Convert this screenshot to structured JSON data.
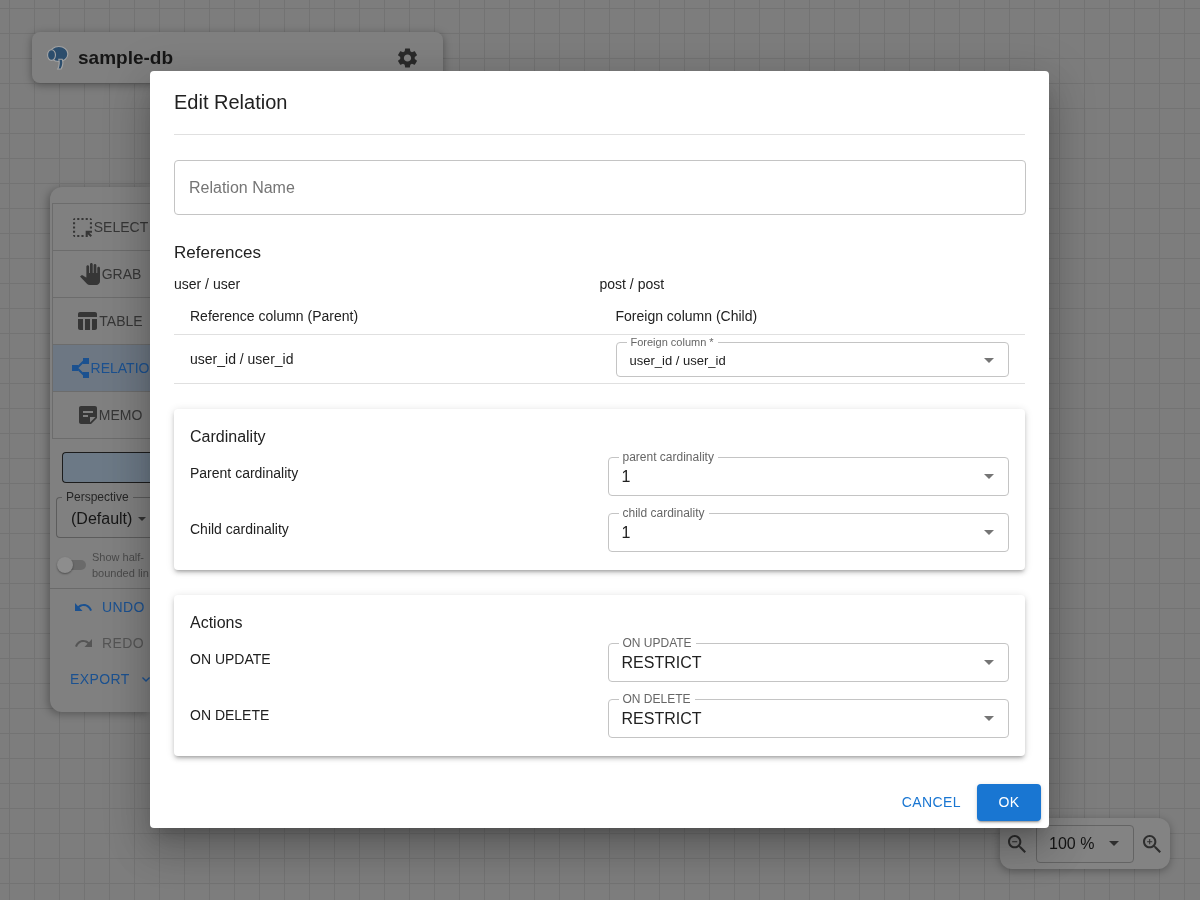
{
  "header": {
    "title": "sample-db"
  },
  "toolbar": {
    "tools": [
      {
        "kind": "select",
        "label": "SELECT",
        "selected": false
      },
      {
        "kind": "grab",
        "label": "GRAB",
        "selected": false
      },
      {
        "kind": "table",
        "label": "TABLE",
        "selected": false
      },
      {
        "kind": "relation",
        "label": "RELATIO",
        "selected": true
      },
      {
        "kind": "memo",
        "label": "MEMO",
        "selected": false
      }
    ],
    "perspective": {
      "label": "Perspective",
      "value": "(Default)"
    },
    "half_bounded_toggle": {
      "on": false,
      "label_lines": [
        "Show half-",
        "bounded lin"
      ]
    },
    "history": [
      {
        "kind": "undo",
        "label": "UNDO",
        "disabled": false
      },
      {
        "kind": "redo",
        "label": "REDO",
        "disabled": true
      }
    ],
    "export": {
      "label": "EXPORT"
    }
  },
  "dialog": {
    "title": "Edit Relation",
    "relation_name": {
      "placeholder": "Relation Name"
    },
    "references": {
      "heading": "References",
      "parent_table": "user / user",
      "child_table": "post / post",
      "columns": [
        "Reference column (Parent)",
        "Foreign column (Child)"
      ],
      "rows": [
        {
          "reference_column": "user_id / user_id",
          "foreign_column": {
            "label": "Foreign column *",
            "value": "user_id / user_id"
          }
        }
      ]
    },
    "cardinality": {
      "heading": "Cardinality",
      "rows": [
        {
          "label": "Parent cardinality",
          "field_label": "parent cardinality",
          "value": "1"
        },
        {
          "label": "Child cardinality",
          "field_label": "child cardinality",
          "value": "1"
        }
      ]
    },
    "actions": {
      "heading": "Actions",
      "rows": [
        {
          "label": "ON UPDATE",
          "field_label": "ON UPDATE",
          "value": "RESTRICT"
        },
        {
          "label": "ON DELETE",
          "field_label": "ON DELETE",
          "value": "RESTRICT"
        }
      ]
    },
    "buttons": [
      {
        "kind": "text",
        "label": "CANCEL"
      },
      {
        "kind": "contained",
        "label": "OK"
      }
    ]
  },
  "zoom_control": {
    "value": "100 %"
  }
}
